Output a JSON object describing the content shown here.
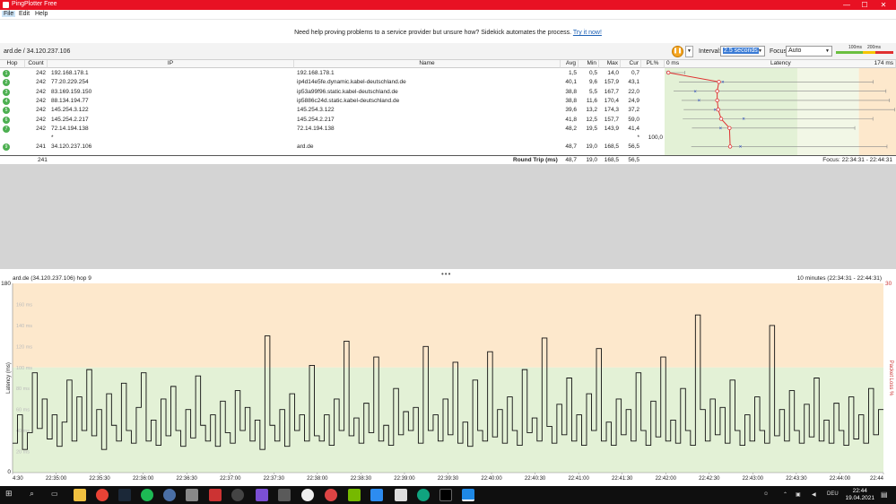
{
  "window": {
    "title": "PingPlotter Free",
    "minimize": "—",
    "maximize": "☐",
    "close": "✕"
  },
  "menu": [
    "File",
    "Edit",
    "Help"
  ],
  "banner": {
    "text": "Need help proving problems to a service provider but unsure how? Sidekick automates the process.",
    "link": "Try it now!"
  },
  "target": "ard.de / 34.120.237.106",
  "toolbar": {
    "interval_label": "Interval:",
    "interval_value": "2.5 seconds",
    "focus_label": "Focus:",
    "focus_value": "Auto",
    "scale_100": "100ms",
    "scale_200": "200ms",
    "colors": {
      "good": "#6abf40",
      "warn": "#f5c400",
      "bad": "#e03030"
    }
  },
  "table": {
    "headers": [
      "Hop",
      "Count",
      "IP",
      "Name",
      "Avg",
      "Min",
      "Max",
      "Cur",
      "PL%",
      "0 ms",
      "Latency",
      "174 ms"
    ],
    "rows": [
      {
        "hop": "1",
        "count": "242",
        "ip": "192.168.178.1",
        "name": "192.168.178.1",
        "avg": "1,5",
        "min": "0,5",
        "max": "14,0",
        "cur": "0,7",
        "pl": ""
      },
      {
        "hop": "2",
        "count": "242",
        "ip": "77.20.229.254",
        "name": "ip4d14e5fe.dynamic.kabel-deutschland.de",
        "avg": "40,1",
        "min": "9,6",
        "max": "157,9",
        "cur": "43,1",
        "pl": ""
      },
      {
        "hop": "3",
        "count": "242",
        "ip": "83.169.159.150",
        "name": "ip53a99f96.static.kabel-deutschland.de",
        "avg": "38,8",
        "min": "5,5",
        "max": "167,7",
        "cur": "22,0",
        "pl": ""
      },
      {
        "hop": "4",
        "count": "242",
        "ip": "88.134.194.77",
        "name": "ip5886c24d.static.kabel-deutschland.de",
        "avg": "38,8",
        "min": "11,6",
        "max": "170,4",
        "cur": "24,9",
        "pl": ""
      },
      {
        "hop": "5",
        "count": "242",
        "ip": "145.254.3.122",
        "name": "145.254.3.122",
        "avg": "39,6",
        "min": "13,2",
        "max": "174,3",
        "cur": "37,2",
        "pl": ""
      },
      {
        "hop": "6",
        "count": "242",
        "ip": "145.254.2.217",
        "name": "145.254.2.217",
        "avg": "41,8",
        "min": "12,5",
        "max": "157,7",
        "cur": "59,0",
        "pl": ""
      },
      {
        "hop": "7",
        "count": "242",
        "ip": "72.14.194.138",
        "name": "72.14.194.138",
        "avg": "48,2",
        "min": "19,5",
        "max": "143,9",
        "cur": "41,4",
        "pl": ""
      },
      {
        "hop": "",
        "count": "",
        "ip": "*",
        "name": "",
        "avg": "",
        "min": "",
        "max": "",
        "cur": "*",
        "pl": "100,0"
      },
      {
        "hop": "9",
        "count": "241",
        "ip": "34.120.237.106",
        "name": "ard.de",
        "avg": "48,7",
        "min": "19,0",
        "max": "168,5",
        "cur": "56,5",
        "pl": ""
      }
    ],
    "roundtrip": {
      "count": "241",
      "label": "Round Trip (ms)",
      "avg": "48,7",
      "min": "19,0",
      "max": "168,5",
      "cur": "56,5",
      "focus": "Focus: 22:34:31 - 22:44:31"
    },
    "latency_markers": [
      {
        "avg": 1.5,
        "min": 0.5,
        "max": 14.0,
        "cur": 0.7
      },
      {
        "avg": 40.1,
        "min": 9.6,
        "max": 157.9,
        "cur": 43.1
      },
      {
        "avg": 38.8,
        "min": 5.5,
        "max": 167.7,
        "cur": 22.0
      },
      {
        "avg": 38.8,
        "min": 11.6,
        "max": 170.4,
        "cur": 24.9
      },
      {
        "avg": 39.6,
        "min": 13.2,
        "max": 174.3,
        "cur": 37.2
      },
      {
        "avg": 41.8,
        "min": 12.5,
        "max": 157.7,
        "cur": 59.0
      },
      {
        "avg": 48.2,
        "min": 19.5,
        "max": 143.9,
        "cur": 41.4
      },
      null,
      {
        "avg": 48.7,
        "min": 19.0,
        "max": 168.5,
        "cur": 56.5
      }
    ]
  },
  "graph": {
    "title": "ard.de (34.120.237.106) hop 9",
    "range": "10 minutes (22:34:31 - 22:44:31)",
    "ylabel": "Latency (ms)",
    "y2label": "Packet Loss %",
    "ytop": "180",
    "ybottom": "0",
    "y2top": "30",
    "x_ticks": [
      "4:30",
      "22:35:00",
      "22:35:30",
      "22:36:00",
      "22:36:30",
      "22:37:00",
      "22:37:30",
      "22:38:00",
      "22:38:30",
      "22:39:00",
      "22:39:30",
      "22:40:00",
      "22:40:30",
      "22:41:00",
      "22:41:30",
      "22:42:00",
      "22:42:30",
      "22:43:00",
      "22:43:30",
      "22:44:00",
      "22:44"
    ],
    "inner_ticks": [
      "160 ms",
      "140 ms",
      "120 ms",
      "100 ms",
      "80 ms",
      "60 ms",
      "40 ms",
      "20 ms"
    ]
  },
  "chart_data": {
    "type": "line",
    "title": "ard.de (34.120.237.106) hop 9",
    "xlabel": "",
    "ylabel": "Latency (ms)",
    "ylim": [
      0,
      180
    ],
    "y2label": "Packet Loss %",
    "y2lim": [
      0,
      30
    ],
    "zones": [
      {
        "from": 0,
        "to": 100,
        "color": "#e3f1d6"
      },
      {
        "from": 100,
        "to": 180,
        "color": "#fde8cc"
      }
    ],
    "series": [
      {
        "values": [
          28,
          55,
          22,
          38,
          95,
          42,
          70,
          32,
          55,
          25,
          48,
          88,
          30,
          72,
          40,
          98,
          35,
          60,
          22,
          75,
          45,
          30,
          85,
          40,
          28,
          62,
          95,
          30,
          50,
          26,
          70,
          35,
          82,
          40,
          25,
          60,
          33,
          92,
          45,
          30,
          55,
          25,
          68,
          38,
          28,
          78,
          40,
          62,
          30,
          50,
          22,
          130,
          45,
          30,
          60,
          25,
          75,
          40,
          55,
          30,
          102,
          35,
          30,
          55,
          26,
          70,
          40,
          125,
          35,
          52,
          28,
          66,
          38,
          110,
          30,
          45,
          26,
          80,
          36,
          58,
          40,
          62,
          28,
          120,
          40,
          55,
          30,
          70,
          36,
          105,
          28,
          48,
          25,
          88,
          40,
          30,
          115,
          34,
          60,
          28,
          72,
          40,
          26,
          98,
          38,
          52,
          30,
          128,
          44,
          28,
          65,
          36,
          90,
          30,
          55,
          26,
          75,
          40,
          118,
          30,
          48,
          26,
          70,
          36,
          60,
          30,
          95,
          40,
          26,
          68,
          34,
          110,
          30,
          50,
          28,
          80,
          40,
          26,
          150,
          60,
          30,
          70,
          36,
          62,
          28,
          88,
          40,
          26,
          55,
          30,
          72,
          40,
          28,
          140,
          35,
          60,
          30,
          78,
          40,
          28,
          65,
          34,
          90,
          30,
          50,
          28,
          66,
          40,
          26,
          72,
          32,
          55,
          28,
          80,
          36,
          60
        ]
      }
    ]
  },
  "taskbar": {
    "tray_lang": "DEU",
    "time": "22:44",
    "date": "19.04.2021"
  }
}
